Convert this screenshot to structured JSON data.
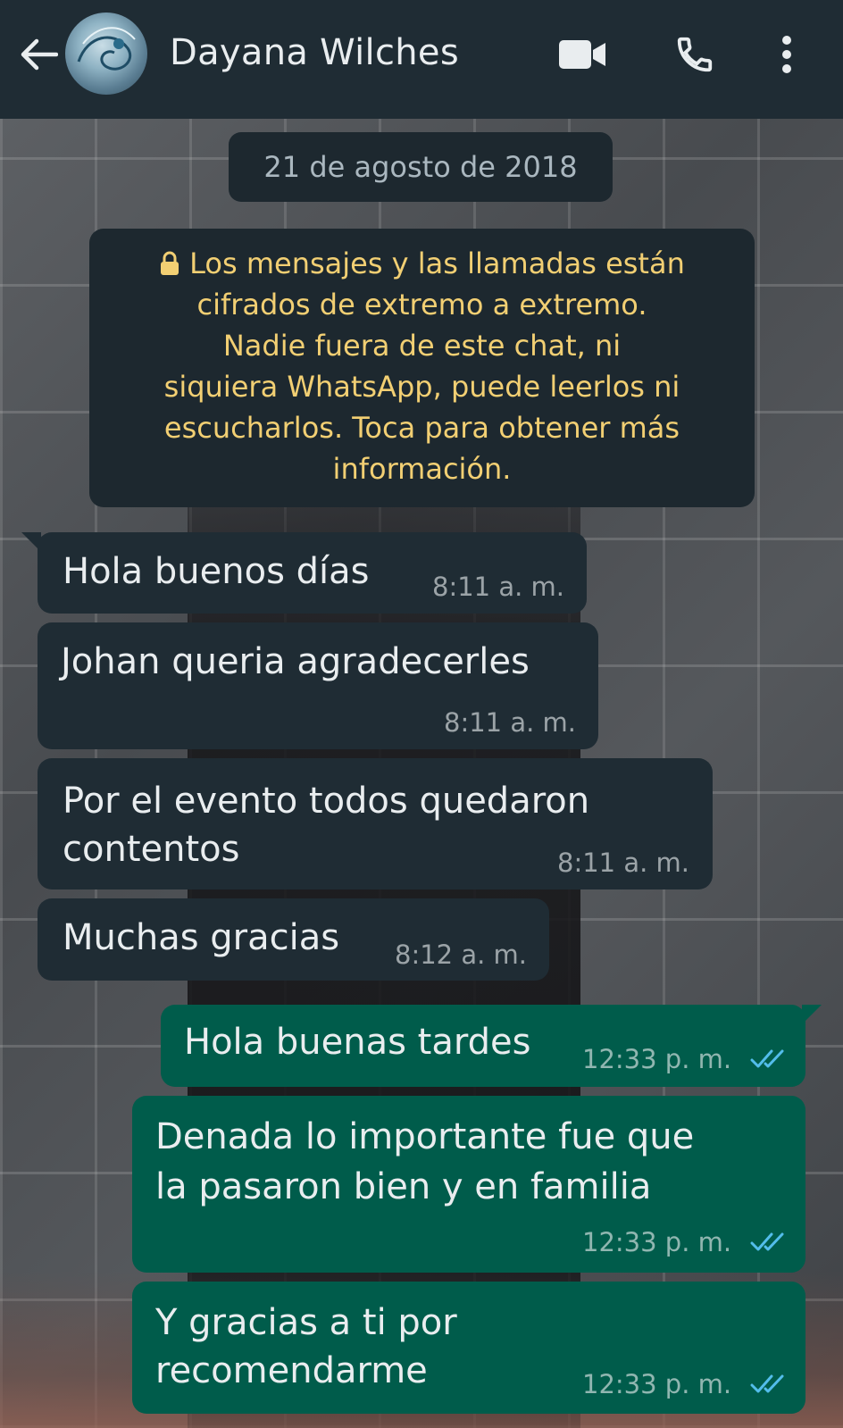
{
  "header": {
    "contact_name": "Dayana Wilches",
    "icons": [
      "back-arrow-icon",
      "video-call-icon",
      "phone-icon",
      "more-vert-icon"
    ]
  },
  "chat": {
    "date_chip": "21 de agosto de 2018",
    "system_notice": {
      "icon": "lock-icon",
      "text_lines": [
        "Los mensajes y las llamadas están",
        "cifrados de extremo a extremo.",
        "Nadie fuera de este chat, ni",
        "siquiera WhatsApp, puede leerlos ni",
        "escucharlos. Toca para obtener más",
        "información."
      ]
    },
    "messages": [
      {
        "direction": "incoming",
        "lines": [
          "Hola buenos días"
        ],
        "time": "8:11 a. m."
      },
      {
        "direction": "incoming",
        "lines": [
          "Johan queria agradecerles"
        ],
        "time": "8:11 a. m."
      },
      {
        "direction": "incoming",
        "lines": [
          "Por el evento todos quedaron",
          "contentos"
        ],
        "time": "8:11 a. m."
      },
      {
        "direction": "incoming",
        "lines": [
          "Muchas gracias"
        ],
        "time": "8:12 a. m."
      },
      {
        "direction": "outgoing",
        "lines": [
          "Hola buenas tardes"
        ],
        "time": "12:33 p. m.",
        "status": "read"
      },
      {
        "direction": "outgoing",
        "lines": [
          "Denada lo importante fue que",
          "la pasaron bien y en familia"
        ],
        "time": "12:33 p. m.",
        "status": "read"
      },
      {
        "direction": "outgoing",
        "lines": [
          "Y gracias a ti por",
          "recomendarme"
        ],
        "time": "12:33 p. m.",
        "status": "read"
      }
    ]
  },
  "colors": {
    "header_bg": "#1f2c34",
    "incoming_bubble": "#1f2c34",
    "outgoing_bubble": "#005c4b",
    "notice_text": "#f2cf73",
    "read_check": "#53bdeb"
  }
}
